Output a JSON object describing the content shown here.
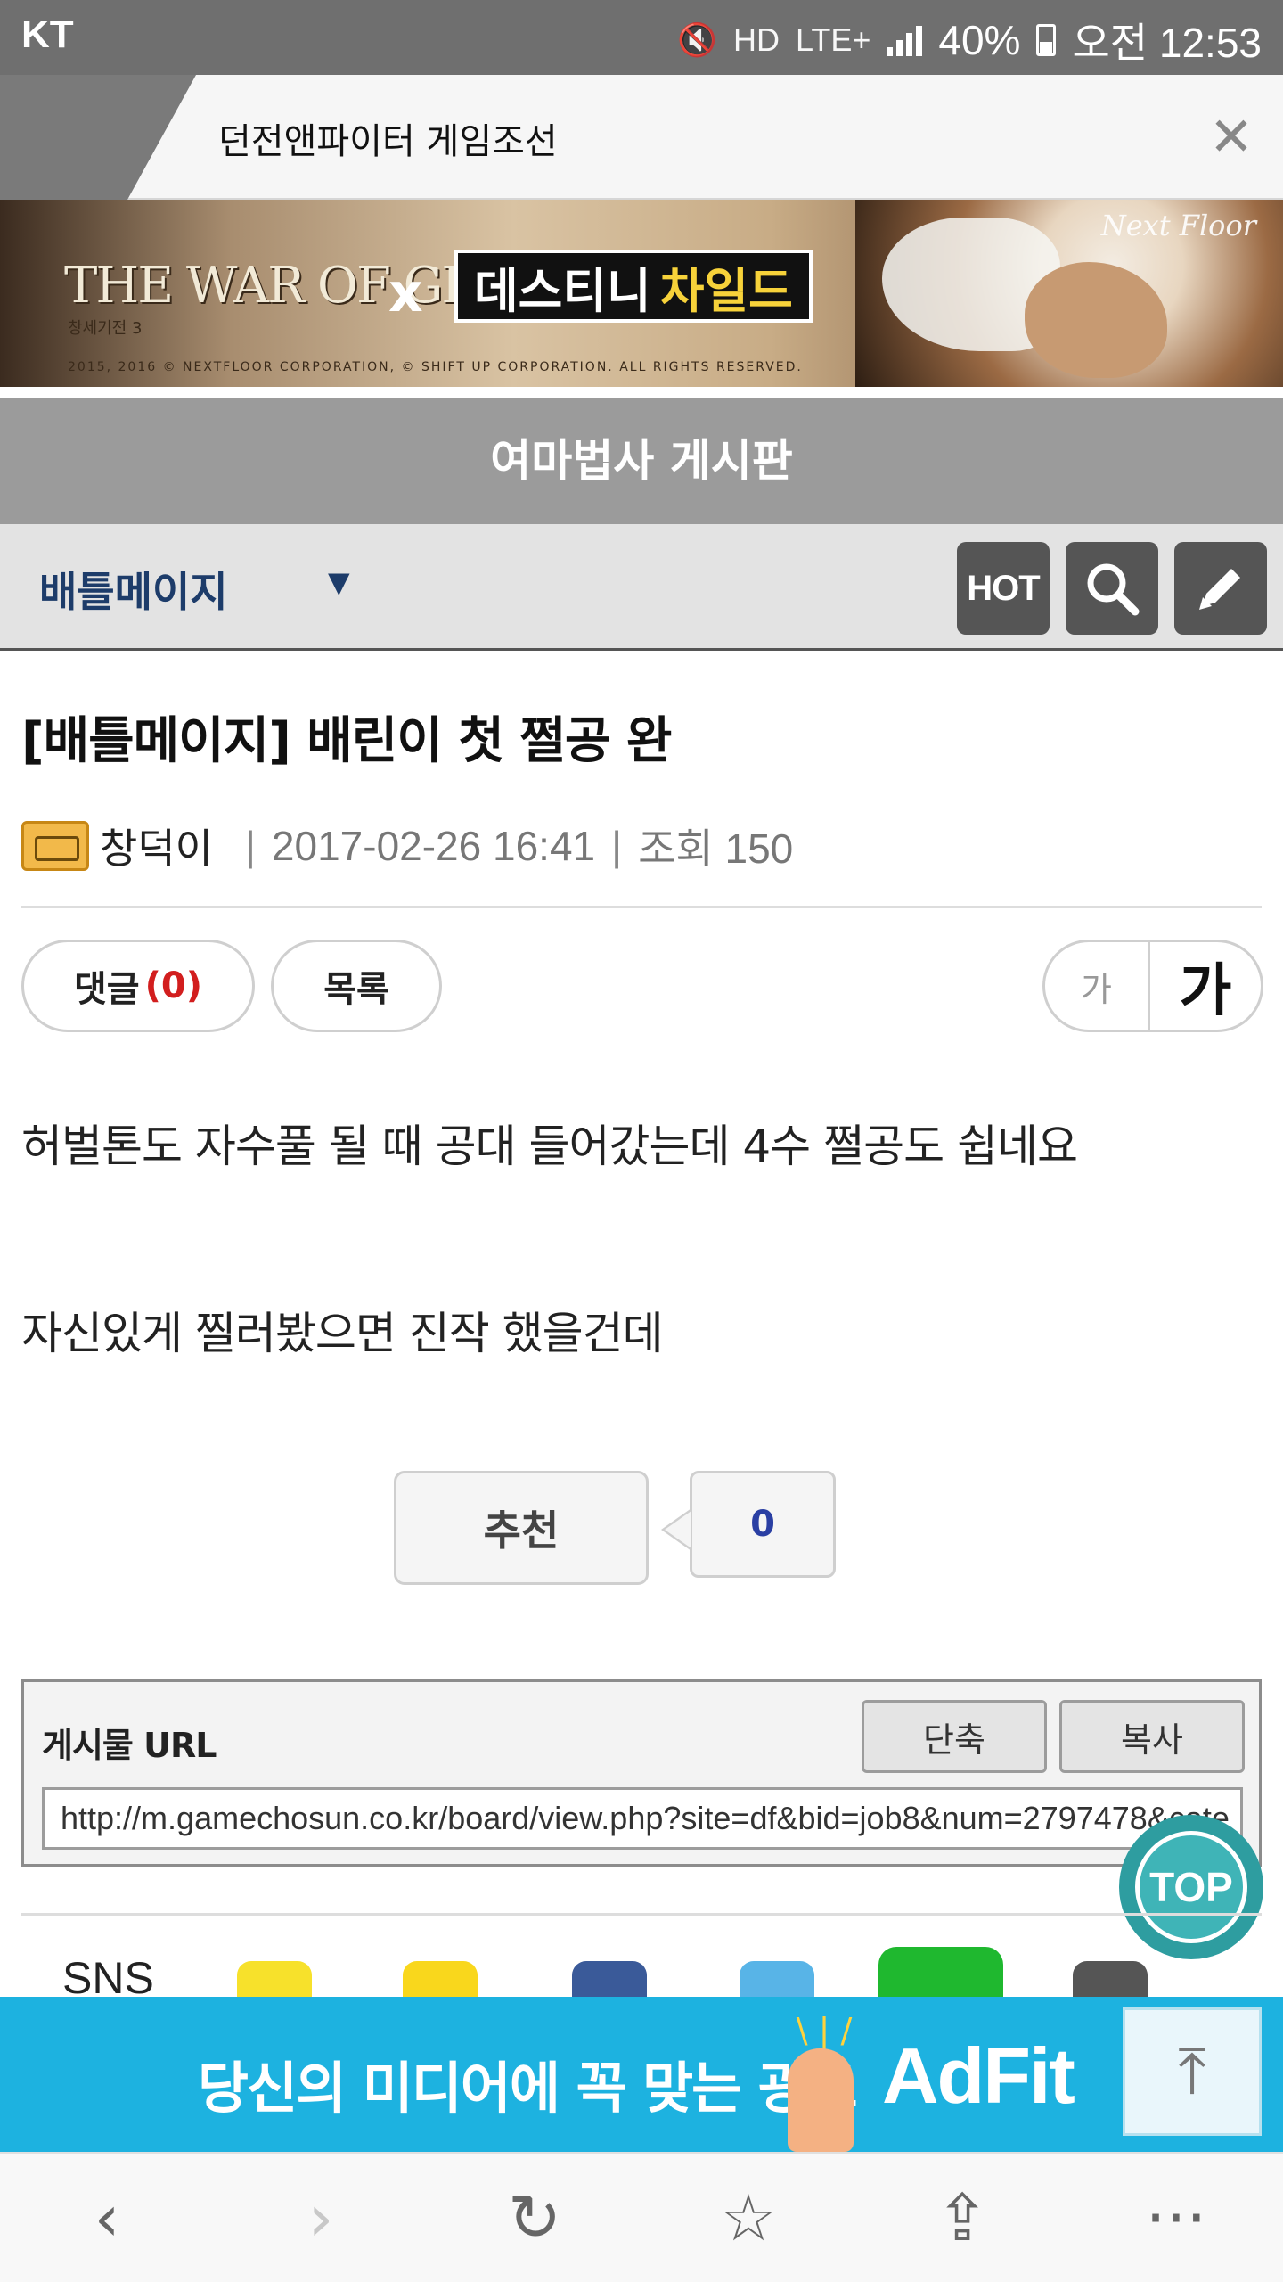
{
  "status_bar": {
    "carrier": "KT",
    "network": "LTE+",
    "battery": "40%",
    "time": "오전 12:53"
  },
  "tab": {
    "title": "던전앤파이터 게임조선",
    "close_icon": "close-icon"
  },
  "banner": {
    "title": "THE WAR OF GENESIS III",
    "subtitle": "창세기전 3",
    "x": "x",
    "logo_part1": "데스티니",
    "logo_part2": "차일드",
    "brand": "Next Floor",
    "copyright": "2015, 2016 © NEXTFLOOR CORPORATION, © SHIFT UP CORPORATION. ALL RIGHTS RESERVED."
  },
  "board": {
    "title": "여마법사 게시판"
  },
  "category": {
    "label": "배틀메이지",
    "arrow": "▼",
    "hot_label": "HOT",
    "search_icon": "search-icon",
    "write_icon": "pencil-icon"
  },
  "post": {
    "title": "[배틀메이지] 배린이 첫 쩔공 완",
    "author": "창덕이",
    "separator": "|",
    "date": "2017-02-26 16:41",
    "views": "조회 150",
    "body": [
      "허벌톤도 자수풀 될 때 공대 들어갔는데 4수 쩔공도 쉽네요",
      "자신있게 찔러봤으면 진작 했을건데"
    ]
  },
  "actions": {
    "comments_label": "댓글",
    "comments_count": "(0)",
    "list_label": "목록",
    "font_small": "가",
    "font_large": "가"
  },
  "recommend": {
    "label": "추천",
    "count": "0"
  },
  "url_box": {
    "label": "게시물 URL",
    "shorten_label": "단축",
    "copy_label": "복사",
    "url": "http://m.gamechosun.co.kr/board/view.php?site=df&bid=job8&num=2797478&cate"
  },
  "top_button": {
    "label": "TOP"
  },
  "sns": {
    "label": "SNS"
  },
  "ad": {
    "text": "당신의 미디어에 꼭 맞는 광고",
    "brand": "AdFit",
    "top_arrow": "⤒"
  },
  "bottom_nav": {
    "back": "‹",
    "forward": "›",
    "refresh": "↻",
    "bookmark": "☆",
    "share": "⇪",
    "more": "···"
  },
  "colors": {
    "status_bar": "#6f6f6f",
    "board_bar": "#9b9b9b",
    "category_text": "#1d3c6a",
    "comment_count": "#d21e1e",
    "recommend_count": "#2a3fa3",
    "top_fab": "#2e9da0",
    "ad_bg": "#1db2e0"
  }
}
